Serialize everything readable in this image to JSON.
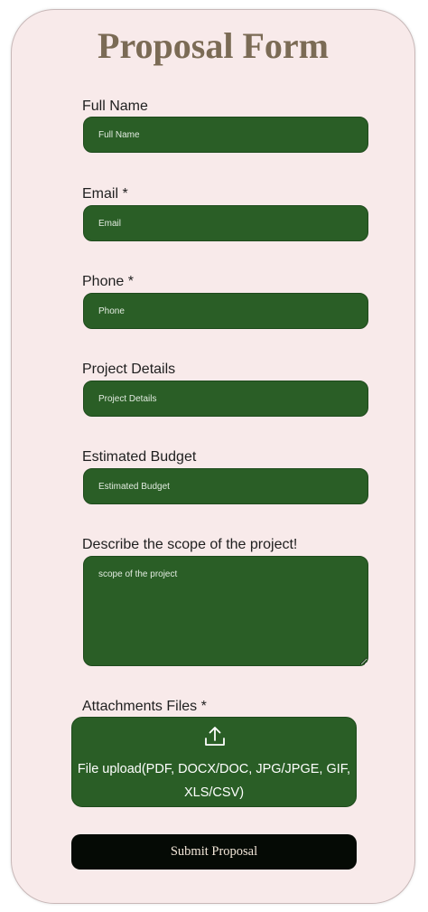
{
  "form": {
    "title": "Proposal Form",
    "fields": [
      {
        "label": "Full Name",
        "placeholder": "Full Name"
      },
      {
        "label": "Email *",
        "placeholder": "Email"
      },
      {
        "label": "Phone *",
        "placeholder": "Phone"
      },
      {
        "label": "Project Details",
        "placeholder": "Project Details"
      },
      {
        "label": "Estimated Budget",
        "placeholder": "Estimated Budget"
      }
    ],
    "scope": {
      "label": "Describe the scope of the project!",
      "placeholder": "scope of the project"
    },
    "attachments": {
      "label": "Attachments Files *",
      "upload_line1": "File upload(PDF, DOCX/DOC, JPG/JPGE, GIF,",
      "upload_line2": "XLS/CSV)",
      "icon": "upload-icon"
    },
    "submit_label": "Submit Proposal"
  },
  "colors": {
    "card_bg": "#f8eaea",
    "title": "#7b6b55",
    "field_bg": "#2a5e26",
    "submit_bg": "#050a05",
    "submit_text": "#f2e6d8"
  }
}
